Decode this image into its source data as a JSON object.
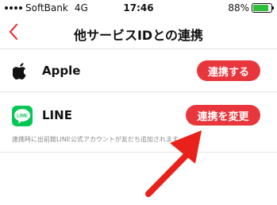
{
  "status_bar": {
    "carrier": "SoftBank",
    "network": "4G",
    "time": "17:46",
    "battery_percent": "88%",
    "battery_level": 0.88,
    "battery_color": "#2fbf3a"
  },
  "nav": {
    "title": "他サービスIDとの連携",
    "back_icon": "chevron-left-icon"
  },
  "services": {
    "apple": {
      "name": "Apple",
      "button_label": "連携する",
      "icon": "apple-icon"
    },
    "line": {
      "name": "LINE",
      "logo_text": "LINE",
      "button_label": "連携を変更",
      "note": "連携時に出前館LINE公式アカウントが友だち追加されます",
      "icon": "line-icon",
      "brand_color": "#06c755"
    }
  },
  "colors": {
    "accent": "#e8363d",
    "annotation_arrow": "#e8221a"
  }
}
